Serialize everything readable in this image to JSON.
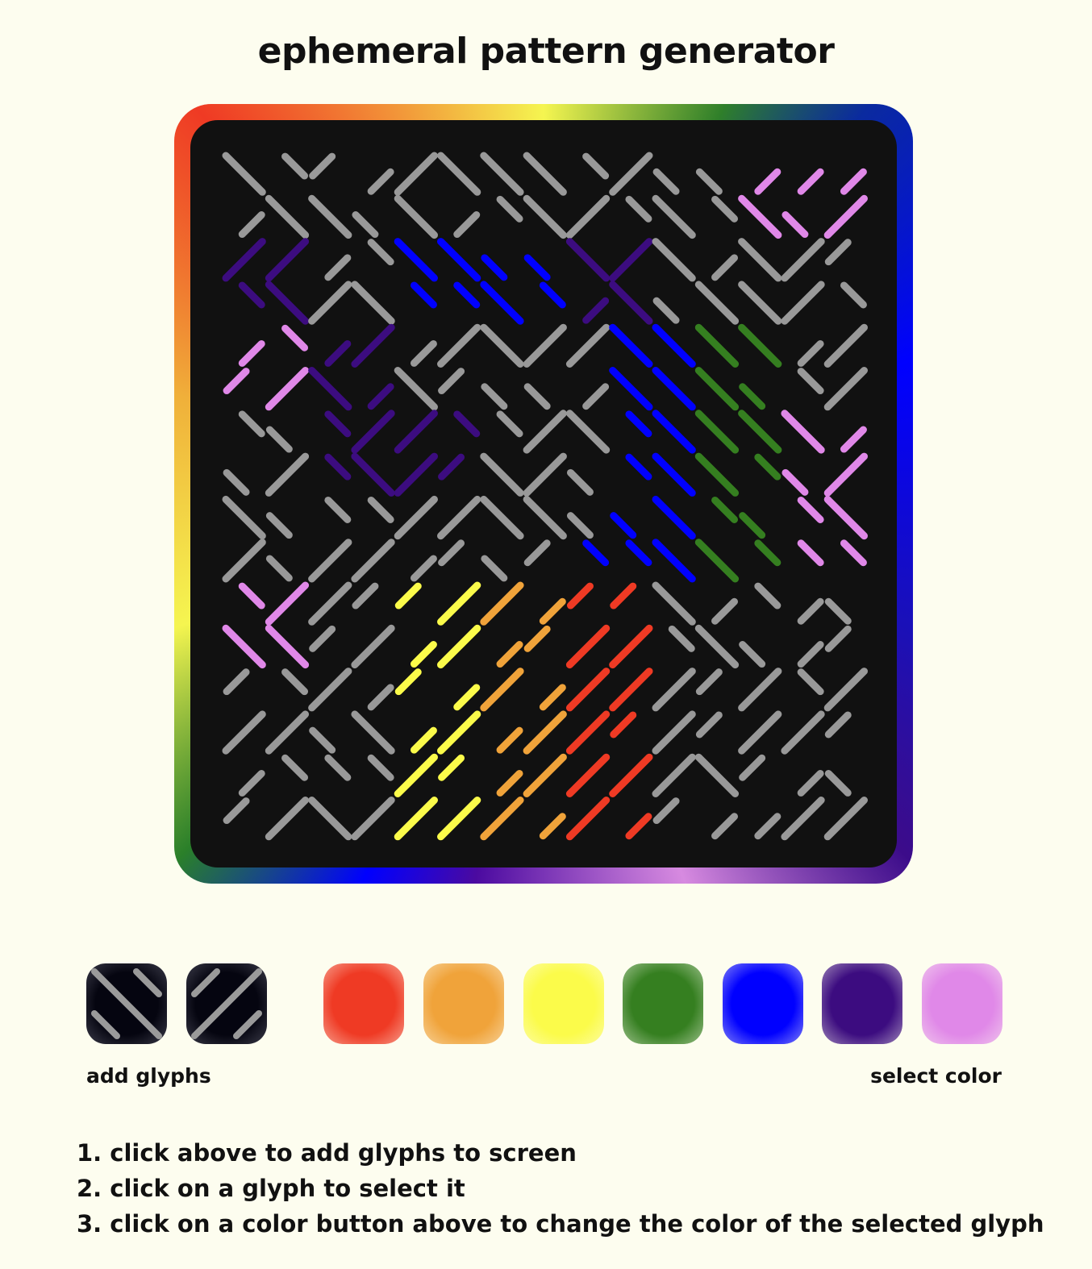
{
  "page": {
    "title": "ephemeral pattern generator"
  },
  "board": {
    "background": "#111111",
    "frame_colors": [
      "#ef3a24",
      "#f0a33a",
      "#f5f550",
      "#2f7f2a",
      "#0000ff",
      "#3c0c8a",
      "#d78ae0"
    ],
    "default_glyph_color": "#999999"
  },
  "glyph_buttons": [
    {
      "name": "backslash-glyph",
      "icon": "diagonal-lines-backslash-icon"
    },
    {
      "name": "slash-glyph",
      "icon": "diagonal-lines-slash-icon"
    }
  ],
  "color_buttons": [
    {
      "name": "red",
      "color": "#ef3a24"
    },
    {
      "name": "orange",
      "color": "#f0a33a"
    },
    {
      "name": "yellow",
      "color": "#fbfb4a"
    },
    {
      "name": "green",
      "color": "#357f20"
    },
    {
      "name": "blue",
      "color": "#0000ff"
    },
    {
      "name": "indigo",
      "color": "#3c0c80"
    },
    {
      "name": "violet",
      "color": "#e088e8"
    }
  ],
  "labels": {
    "add_glyphs": "add glyphs",
    "select_color": "select color"
  },
  "instructions": [
    "1. click above to add glyphs to screen",
    "2. click on a glyph to select it",
    "3. click on a color button above to change the color of the selected glyph"
  ]
}
